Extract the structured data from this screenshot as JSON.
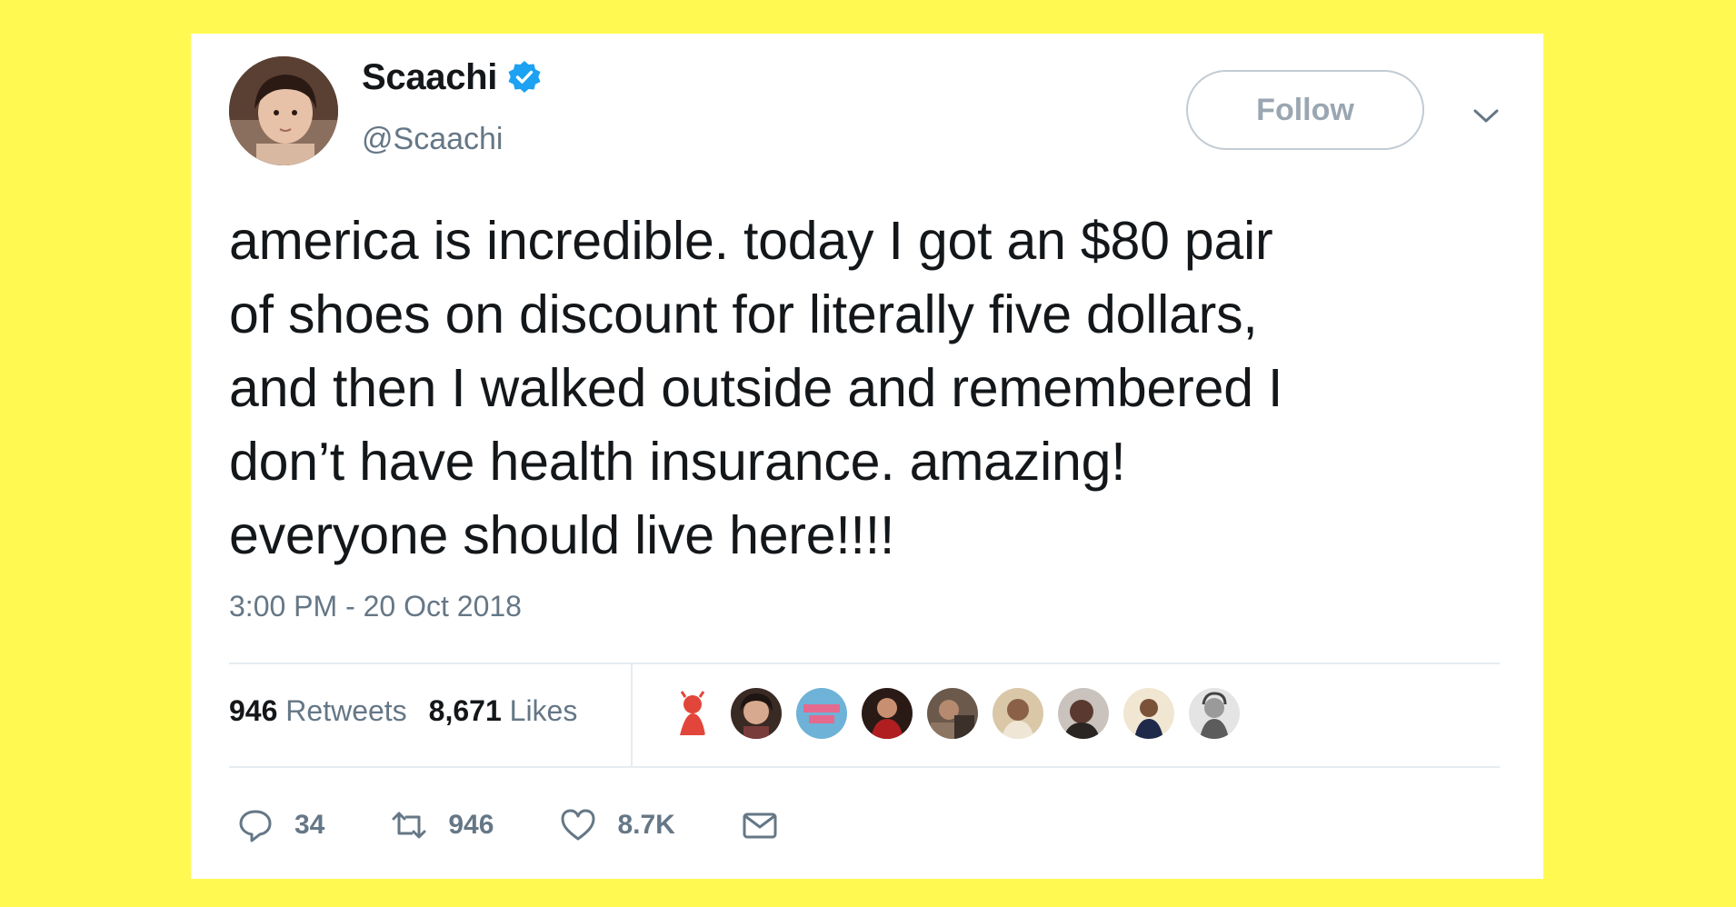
{
  "tweet": {
    "display_name": "Scaachi",
    "handle": "@Scaachi",
    "follow_label": "Follow",
    "text": "america is incredible. today I got an $80 pair\nof shoes on discount for literally five dollars,\nand then I walked outside and remembered I\ndon’t have health insurance. amazing!\neveryone should live here!!!!",
    "timestamp": "3:00 PM - 20 Oct 2018",
    "stats": {
      "retweets_count": "946",
      "retweets_label": "Retweets",
      "likes_count": "8,671",
      "likes_label": "Likes"
    },
    "actions": {
      "reply_count": "34",
      "retweet_count": "946",
      "like_count": "8.7K"
    }
  },
  "colors": {
    "background": "#fff952",
    "verified": "#1da1f2",
    "text": "#14171a",
    "secondary": "#657786"
  },
  "icons": {
    "verified": "verified-badge-icon",
    "chevron": "chevron-down-icon",
    "reply": "reply-icon",
    "retweet": "retweet-icon",
    "like": "heart-icon",
    "message": "envelope-icon"
  }
}
